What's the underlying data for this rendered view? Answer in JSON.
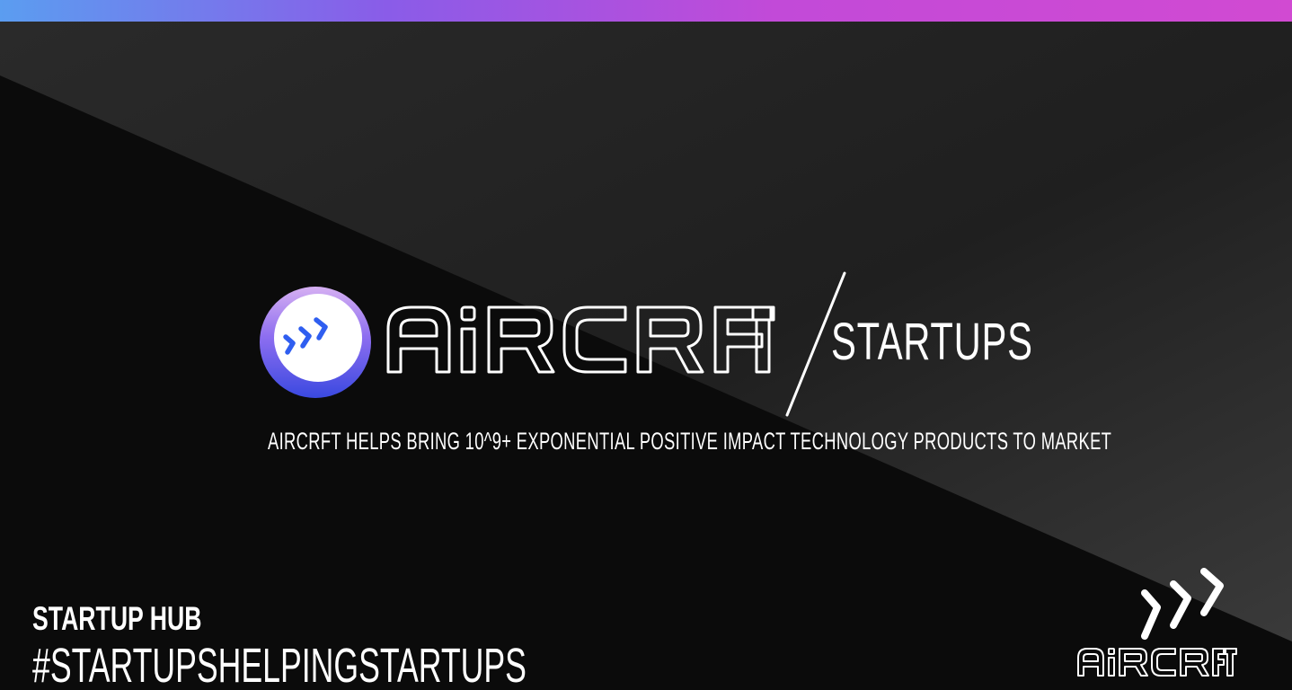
{
  "brand": {
    "name": "AIRCRFT",
    "division": "STARTUPS",
    "logo_icon": "chevrons-right-icon",
    "colors": {
      "gradient_start": "#5b9df0",
      "gradient_mid": "#8a5ce8",
      "gradient_end": "#d14ad2",
      "logo_ring_top": "#c9a2f0",
      "logo_ring_bottom": "#3a49e0",
      "chevron_blue": "#2f5ef0",
      "background": "#0a0a0a",
      "text": "#ffffff"
    }
  },
  "hero": {
    "tagline": "AIRCRFT HELPS BRING 10^9+ EXPONENTIAL POSITIVE IMPACT TECHNOLOGY PRODUCTS TO MARKET"
  },
  "footer": {
    "title": "STARTUP HUB",
    "hashtag": "#STARTUPSHELPINGSTARTUPS",
    "corner_logo_icon": "chevrons-right-icon",
    "corner_wordmark": "AIRCRFT"
  }
}
